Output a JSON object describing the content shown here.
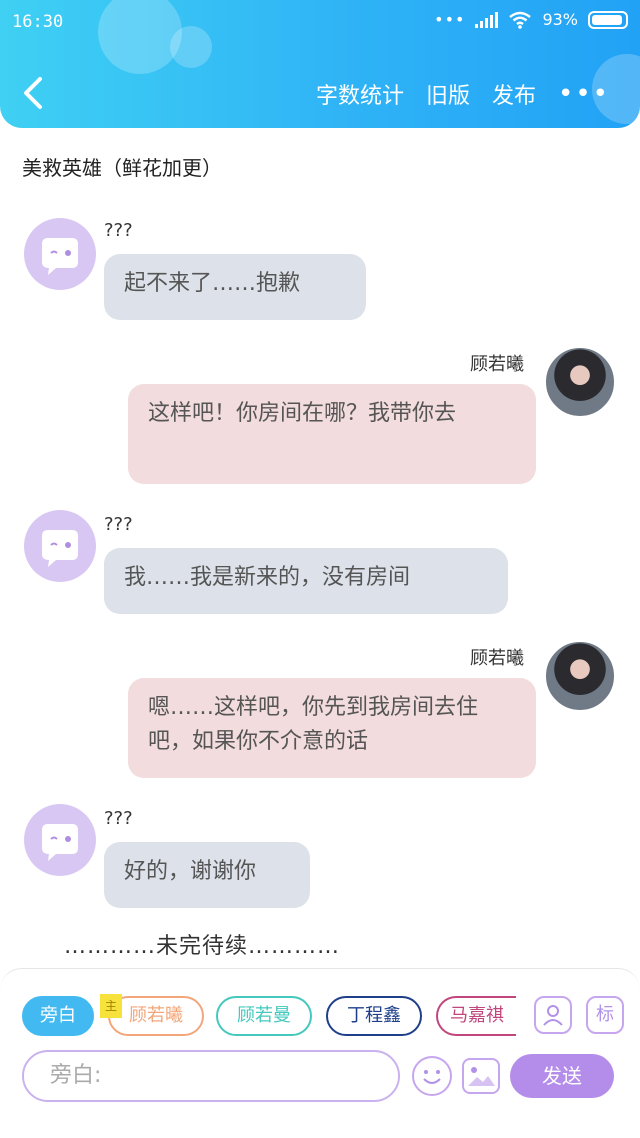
{
  "status": {
    "time": "16:30",
    "battery": "93%"
  },
  "header": {
    "nav": [
      "字数统计",
      "旧版",
      "发布"
    ],
    "more": "•••"
  },
  "chapter_title": "美救英雄（鲜花加更）",
  "messages": [
    {
      "side": "left",
      "sender": "???",
      "text": "起不来了……抱歉"
    },
    {
      "side": "right",
      "sender": "顾若曦",
      "text": "这样吧！你房间在哪？我带你去"
    },
    {
      "side": "left",
      "sender": "???",
      "text": "我……我是新来的，没有房间"
    },
    {
      "side": "right",
      "sender": "顾若曦",
      "text": "嗯……这样吧，你先到我房间去住吧，如果你不介意的话"
    },
    {
      "side": "left",
      "sender": "???",
      "text": "好的，谢谢你"
    }
  ],
  "to_be_continued": "…………未完待续…………",
  "bottom": {
    "roles": [
      {
        "label": "旁白",
        "color": "#42b9f1",
        "active": true
      },
      {
        "label": "顾若曦",
        "color": "#f2a679",
        "active": false
      },
      {
        "label": "顾若曼",
        "color": "#45c8be",
        "active": false
      },
      {
        "label": "丁程鑫",
        "color": "#1e3f8a",
        "active": false
      },
      {
        "label": "马嘉祺",
        "color": "#c2467e",
        "active": false
      }
    ],
    "main_tag": "主",
    "tag_icon_label": "标",
    "input_placeholder": "旁白:",
    "send_label": "发送"
  }
}
